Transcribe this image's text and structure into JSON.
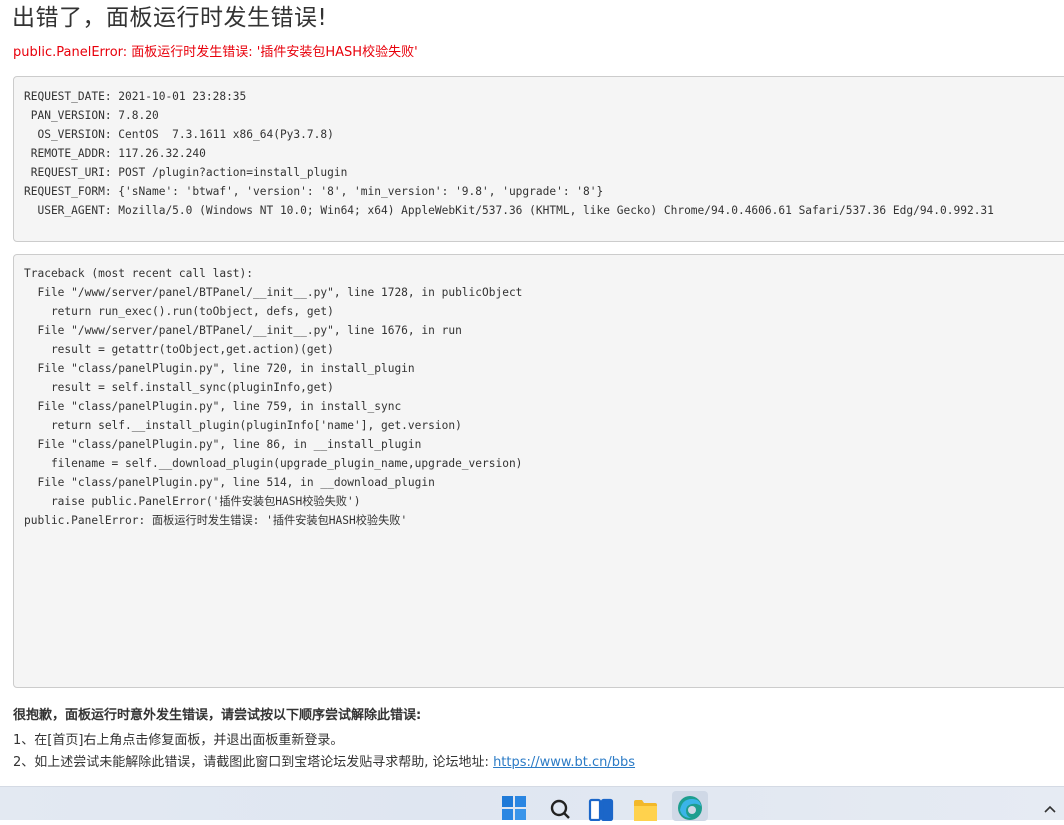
{
  "page": {
    "title": "出错了，面板运行时发生错误!",
    "error_message": "public.PanelError: 面板运行时发生错误: '插件安装包HASH校验失败'"
  },
  "request_info": [
    "REQUEST_DATE: 2021-10-01 23:28:35",
    " PAN_VERSION: 7.8.20",
    "  OS_VERSION: CentOS  7.3.1611 x86_64(Py3.7.8)",
    " REMOTE_ADDR: 117.26.32.240",
    " REQUEST_URI: POST /plugin?action=install_plugin",
    "REQUEST_FORM: {'sName': 'btwaf', 'version': '8', 'min_version': '9.8', 'upgrade': '8'}",
    "  USER_AGENT: Mozilla/5.0 (Windows NT 10.0; Win64; x64) AppleWebKit/537.36 (KHTML, like Gecko) Chrome/94.0.4606.61 Safari/537.36 Edg/94.0.992.31"
  ],
  "traceback": [
    "Traceback (most recent call last):",
    "  File \"/www/server/panel/BTPanel/__init__.py\", line 1728, in publicObject",
    "    return run_exec().run(toObject, defs, get)",
    "  File \"/www/server/panel/BTPanel/__init__.py\", line 1676, in run",
    "    result = getattr(toObject,get.action)(get)",
    "  File \"class/panelPlugin.py\", line 720, in install_plugin",
    "    result = self.install_sync(pluginInfo,get)",
    "  File \"class/panelPlugin.py\", line 759, in install_sync",
    "    return self.__install_plugin(pluginInfo['name'], get.version)",
    "  File \"class/panelPlugin.py\", line 86, in __install_plugin",
    "    filename = self.__download_plugin(upgrade_plugin_name,upgrade_version)",
    "  File \"class/panelPlugin.py\", line 514, in __download_plugin",
    "    raise public.PanelError('插件安装包HASH校验失败')",
    "public.PanelError: 面板运行时发生错误: '插件安装包HASH校验失败'"
  ],
  "help": {
    "heading": "很抱歉，面板运行时意外发生错误，请尝试按以下顺序尝试解除此错误:",
    "step1": "1、在[首页]右上角点击修复面板，并退出面板重新登录。",
    "step2_prefix": "2、如上述尝试未能解除此错误，请截图此窗口到宝塔论坛发贴寻求帮助, 论坛地址: ",
    "forum_link": "https://www.bt.cn/bbs"
  },
  "taskbar": {
    "icons": [
      "windows-start-icon",
      "search-icon",
      "task-view-icon",
      "file-explorer-icon",
      "edge-browser-icon",
      "chevron-up-icon"
    ]
  },
  "colors": {
    "error_red": "#e8000b",
    "link_blue": "#2b7bc6",
    "box_background": "#f5f5f5"
  }
}
